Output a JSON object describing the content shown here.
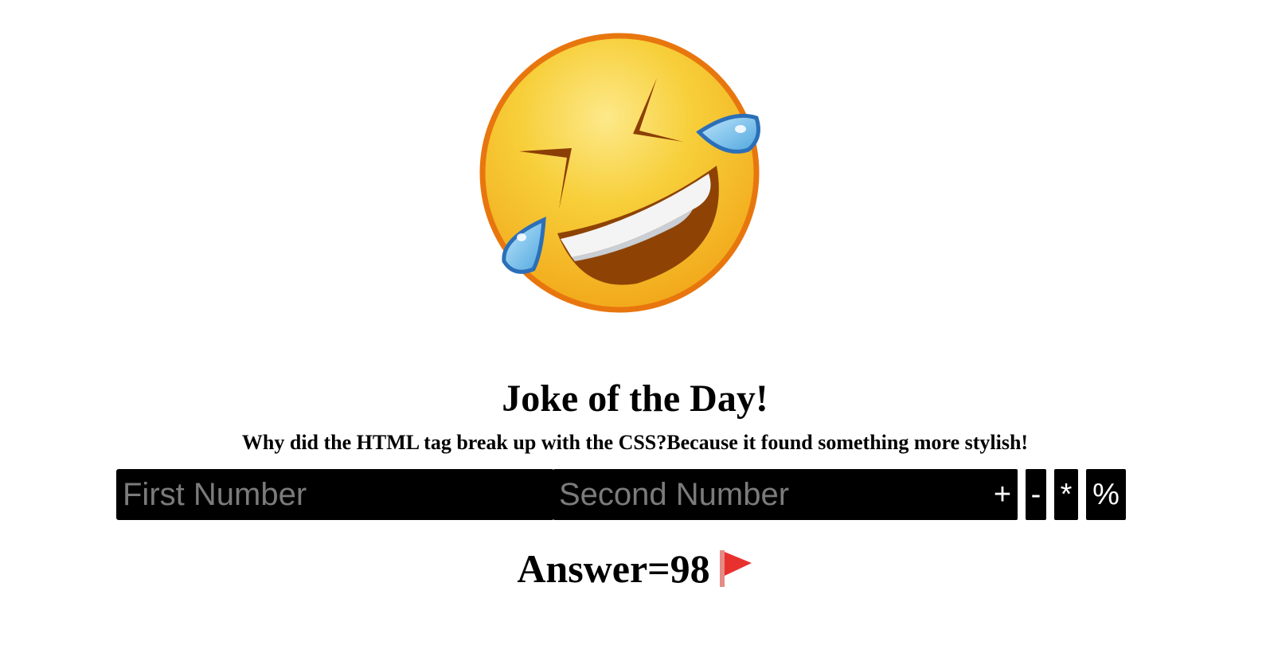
{
  "hero": {
    "icon": "rolling-on-floor-laughing-emoji"
  },
  "heading": {
    "title": "Joke of the Day!",
    "joke": "Why did the HTML tag break up with the CSS?Because it found something more stylish!"
  },
  "calculator": {
    "first_placeholder": "First Number",
    "second_placeholder": "Second Number",
    "first_value": "",
    "second_value": "",
    "buttons": {
      "add": "+",
      "subtract": "-",
      "multiply": "*",
      "modulo": "%"
    }
  },
  "result": {
    "label": "Answer=98",
    "icon": "red-flag-icon"
  },
  "colors": {
    "input_bg": "#000000",
    "placeholder": "#7b7b7b",
    "flag_red": "#e8312f",
    "emoji_yellow": "#f5c22a",
    "emoji_outline": "#e8760e",
    "tear_blue": "#5fb8ea"
  }
}
